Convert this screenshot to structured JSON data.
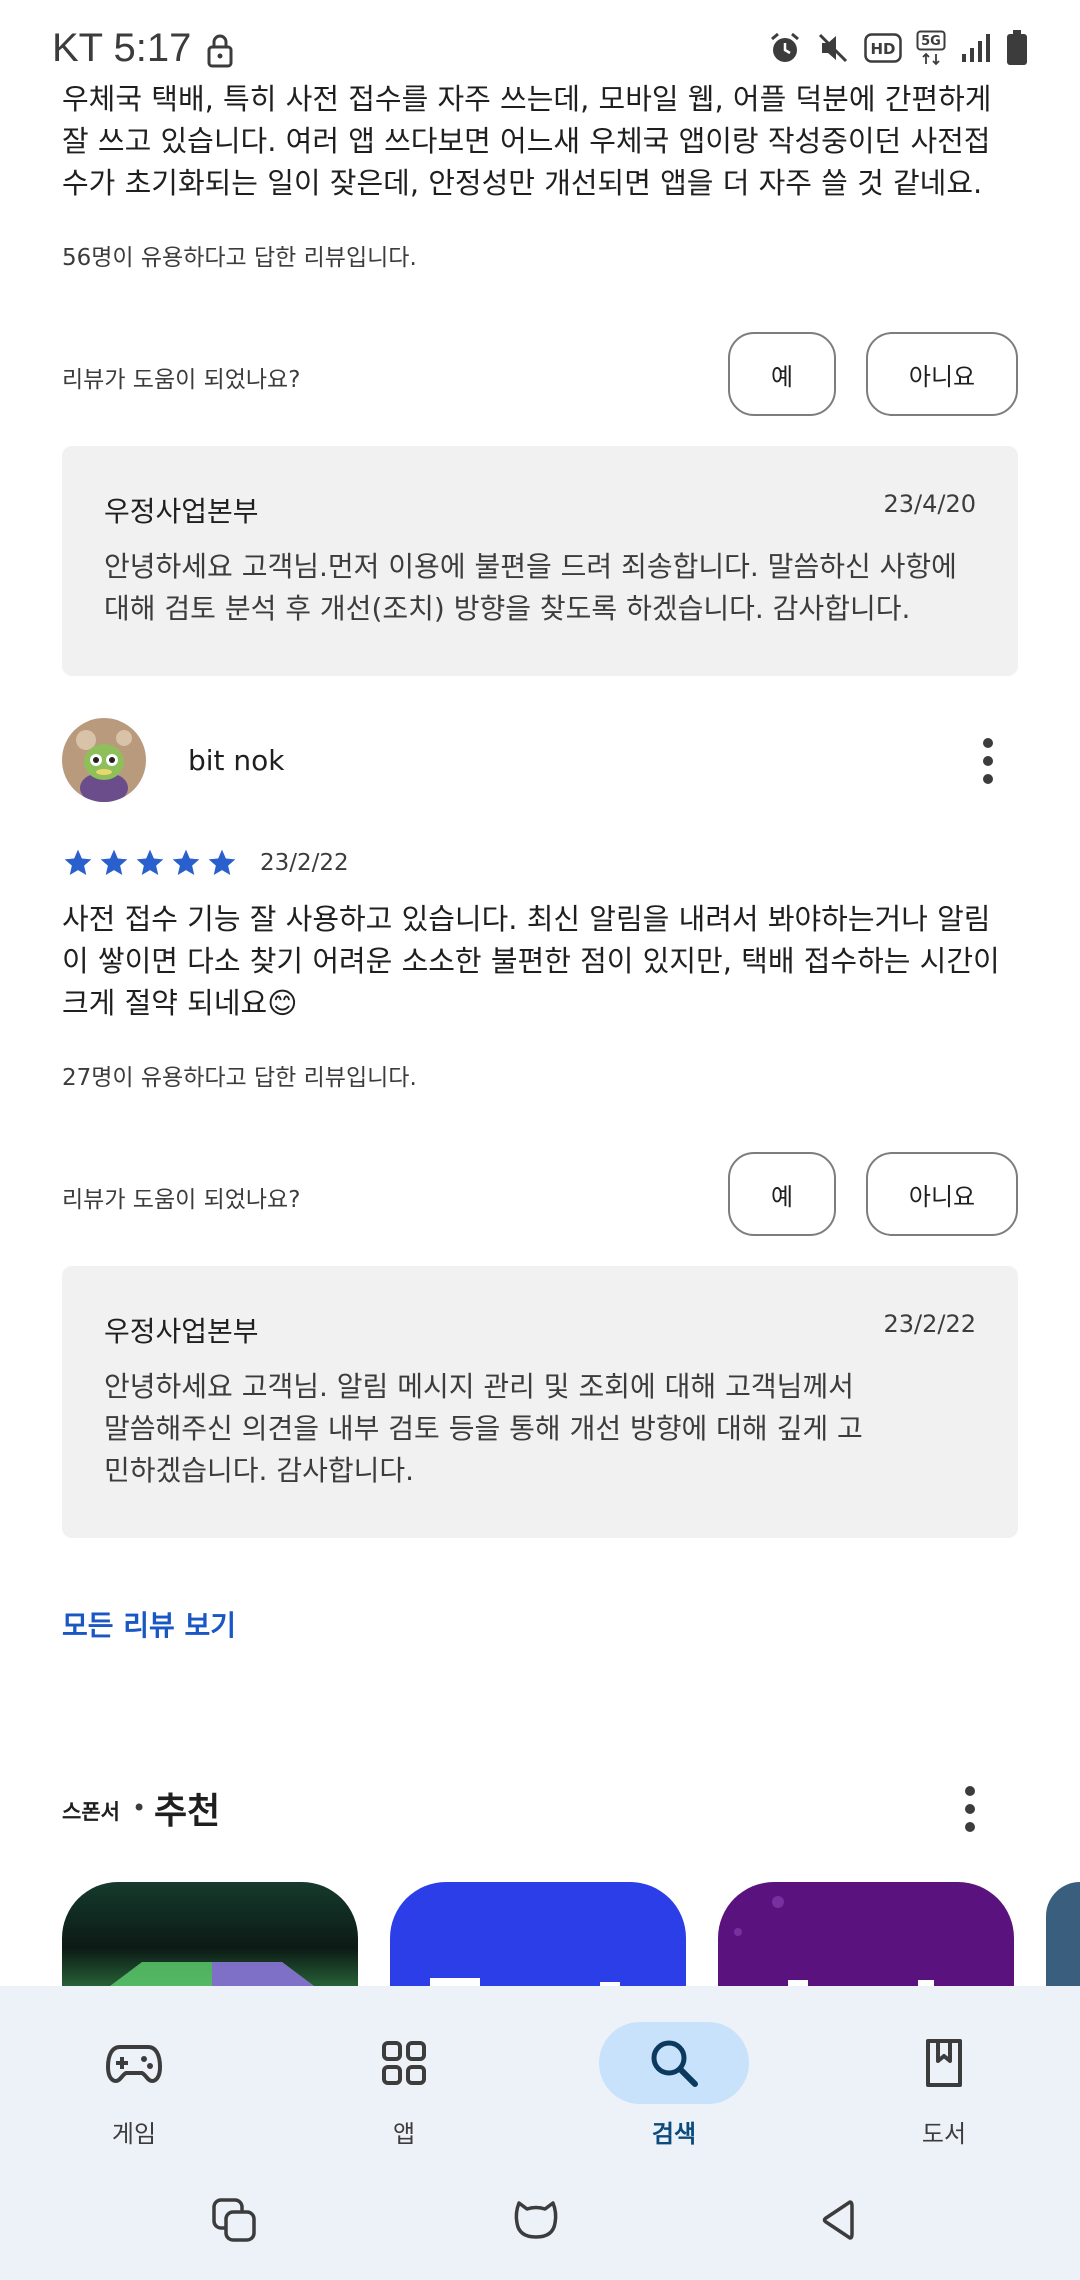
{
  "status_bar": {
    "time": "KT 5:17",
    "icons": [
      "lock-icon",
      "alarm-icon",
      "mute-icon",
      "hd-icon",
      "5g-icon",
      "signal-icon",
      "battery-icon"
    ]
  },
  "review1": {
    "body": "우체국 택배, 특히 사전 접수를 자주 쓰는데, 모바일 웹, 어플 덕분에 간편하게 잘 쓰고 있습니다. 여러 앱 쓰다보면 어느새 우체국 앱이랑 작성중이던 사전접수가 초기화되는 일이 잦은데, 안정성만 개선되면 앱을 더 자주 쓸 것 같네요.",
    "helpful_count": "56명이 유용하다고 답한 리뷰입니다.",
    "helpful_question": "리뷰가 도움이 되었나요?",
    "yes": "예",
    "no": "아니요",
    "reply": {
      "name": "우정사업본부",
      "date": "23/4/20",
      "text": "안녕하세요 고객님.먼저 이용에 불편을 드려 죄송합니다. 말씀하신 사항에 대해 검토 분석 후 개선(조치) 방향을 찾도록 하겠습니다. 감사합니다."
    }
  },
  "review2": {
    "reviewer": "bit nok",
    "rating": 5,
    "date": "23/2/22",
    "body": "사전 접수 기능 잘 사용하고 있습니다. 최신 알림을 내려서 봐야하는거나 알림이 쌓이면 다소 찾기 어려운 소소한 불편한 점이 있지만, 택배 접수하는 시간이 크게 절약 되네요😊",
    "helpful_count": "27명이 유용하다고 답한 리뷰입니다.",
    "helpful_question": "리뷰가 도움이 되었나요?",
    "yes": "예",
    "no": "아니요",
    "reply": {
      "name": "우정사업본부",
      "date": "23/2/22",
      "text": "안녕하세요 고객님. 알림 메시지 관리 및 조회에 대해 고객님께서 말씀해주신 의견을 내부 검토 등을 통해 개선 방향에 대해 깊게 고민하겠습니다. 감사합니다."
    }
  },
  "see_all_reviews": "모든 리뷰 보기",
  "recommend": {
    "sponsor": "스폰서",
    "separator": "•",
    "title": "추천"
  },
  "bottom_nav": {
    "items": [
      {
        "label": "게임",
        "icon": "gamepad-icon"
      },
      {
        "label": "앱",
        "icon": "apps-grid-icon"
      },
      {
        "label": "검색",
        "icon": "search-icon"
      },
      {
        "label": "도서",
        "icon": "book-icon"
      }
    ],
    "active": "검색"
  },
  "colors": {
    "accent": "#1a56c4",
    "star": "#2a5fce",
    "nav_bg": "#edf1f8",
    "nav_active_pill": "#c8e2fb"
  }
}
